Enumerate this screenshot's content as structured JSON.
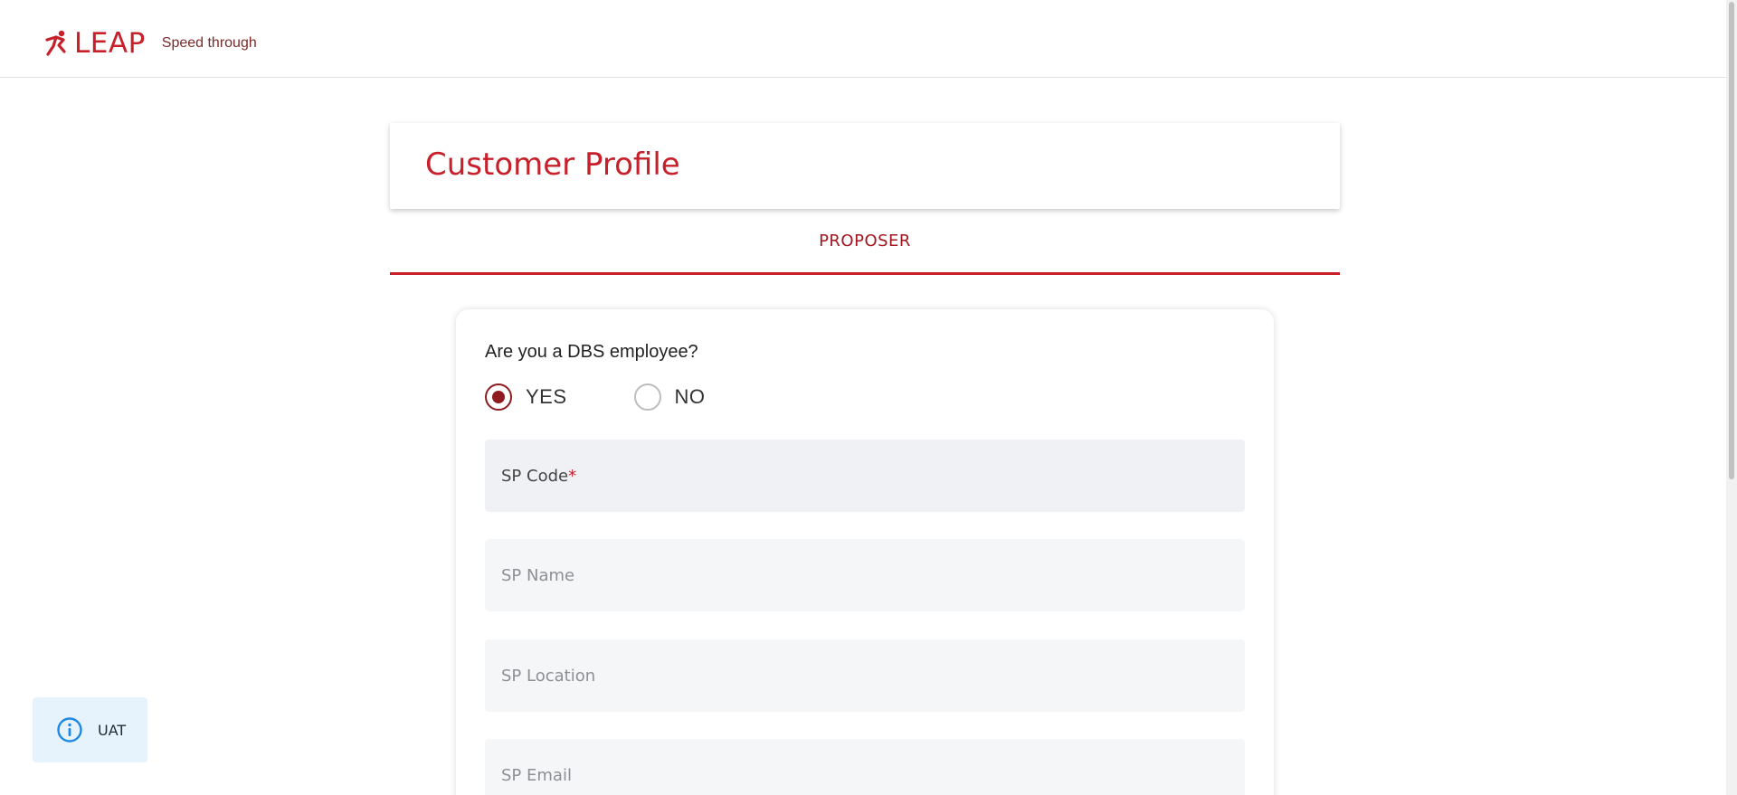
{
  "header": {
    "brand_name": "LEAP",
    "tagline": "Speed through",
    "brand_color": "#c8202a",
    "logo_icon": "runner-icon"
  },
  "title_card": {
    "title": "Customer Profile"
  },
  "tabs": [
    {
      "label": "PROPOSER",
      "active": true
    }
  ],
  "form": {
    "question": "Are you a DBS employee?",
    "options": [
      {
        "label": "YES",
        "selected": true
      },
      {
        "label": "NO",
        "selected": false
      }
    ],
    "fields": [
      {
        "label": "SP Code",
        "required_mark": "*",
        "value": ""
      },
      {
        "label": "SP Name",
        "value": ""
      },
      {
        "label": "SP Location",
        "value": ""
      },
      {
        "label": "SP Email",
        "value": ""
      }
    ]
  },
  "env_badge": {
    "label": "UAT",
    "icon": "info-icon",
    "color": "#1e88e5"
  }
}
